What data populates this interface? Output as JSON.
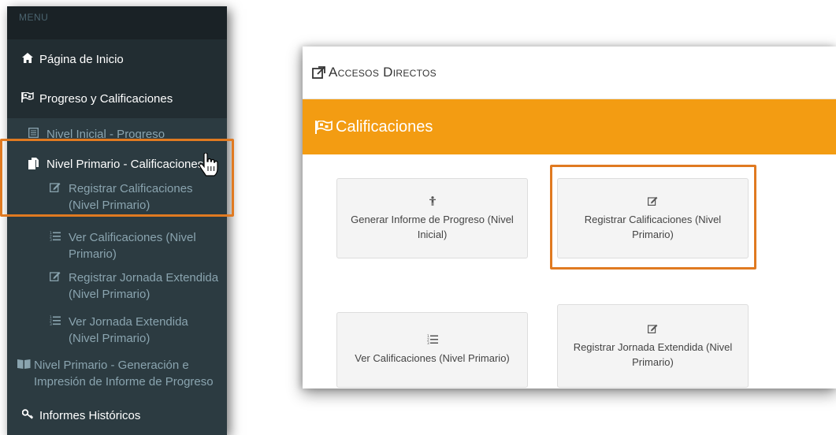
{
  "sidebar": {
    "header": "MENU",
    "items": [
      {
        "icon": "home-icon",
        "glyph": "🏠",
        "label": "Página de Inicio"
      },
      {
        "icon": "flag-checkered-icon",
        "glyph": "⚑",
        "label": "Progreso y Calificaciones"
      },
      {
        "icon": "list-alt-icon",
        "glyph": "▤",
        "label": "Nivel Inicial - Progreso"
      },
      {
        "icon": "file-copy-icon",
        "glyph": "❐",
        "label": "Nivel Primario - Calificaciones"
      },
      {
        "icon": "edit-icon",
        "glyph": "✎",
        "label": "Registrar Calificaciones (Nivel Primario)"
      },
      {
        "icon": "list-ol-icon",
        "glyph": "☰",
        "label": "Ver Calificaciones (Nivel Primario)"
      },
      {
        "icon": "edit-icon",
        "glyph": "✎",
        "label": "Registrar Jornada Extendida (Nivel Primario)"
      },
      {
        "icon": "list-ol-icon",
        "glyph": "☰",
        "label": "Ver Jornada Extendida (Nivel Primario)"
      },
      {
        "icon": "book-icon",
        "glyph": "▯",
        "label": "Nivel Primario - Generación e Impresión de Informe de Progreso"
      },
      {
        "icon": "key-icon",
        "glyph": "⚷",
        "label": "Informes Históricos"
      }
    ]
  },
  "panel": {
    "title": "Accesos Directos",
    "section": "Calificaciones",
    "tiles": [
      {
        "icon": "child-icon",
        "glyph": "✝",
        "label": "Generar Informe de Progreso (Nivel Inicial)"
      },
      {
        "icon": "edit-icon",
        "glyph": "✎",
        "label": "Registrar Calificaciones (Nivel Primario)"
      },
      {
        "icon": "list-ol-icon",
        "glyph": "☰",
        "label": "Ver Calificaciones (Nivel Primario)"
      },
      {
        "icon": "edit-icon",
        "glyph": "✎",
        "label": "Registrar Jornada Extendida (Nivel Primario)"
      }
    ]
  },
  "colors": {
    "sidebar_bg": "#2c3b41",
    "accent_orange": "#f39c12",
    "highlight_border": "#e07a21"
  }
}
